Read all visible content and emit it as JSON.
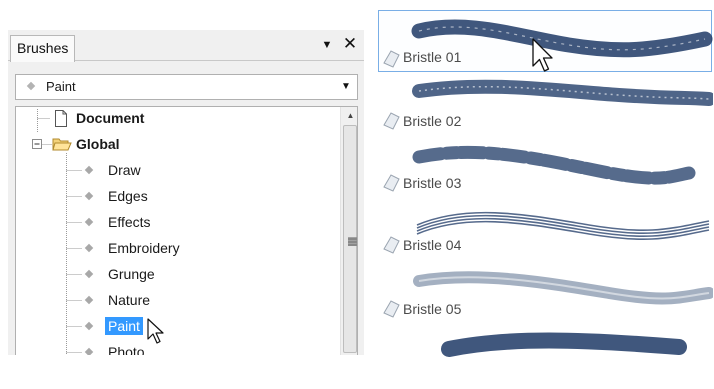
{
  "panel": {
    "tab_label": "Brushes",
    "menu_glyph": "▼",
    "close_glyph": "✕",
    "dropdown": {
      "value": "Paint",
      "arrow_glyph": "▼"
    },
    "scroll_up_glyph": "▲"
  },
  "tree": {
    "document": {
      "label": "Document",
      "icon": "document-icon"
    },
    "global": {
      "label": "Global",
      "icon": "folder-open-icon",
      "expander": "−"
    },
    "children": [
      {
        "label": "Draw"
      },
      {
        "label": "Edges"
      },
      {
        "label": "Effects"
      },
      {
        "label": "Embroidery"
      },
      {
        "label": "Grunge"
      },
      {
        "label": "Nature"
      },
      {
        "label": "Paint",
        "selected": true
      },
      {
        "label": "Photo"
      }
    ]
  },
  "brushes": [
    {
      "label": "Bristle 01",
      "selected": true
    },
    {
      "label": "Bristle 02"
    },
    {
      "label": "Bristle 03"
    },
    {
      "label": "Bristle 04"
    },
    {
      "label": "Bristle 05"
    },
    {
      "label": ""
    }
  ],
  "colors": {
    "selection": "#3399ff",
    "brush_ink": "#1e3a66",
    "brush_selected_border": "#79aee6"
  }
}
